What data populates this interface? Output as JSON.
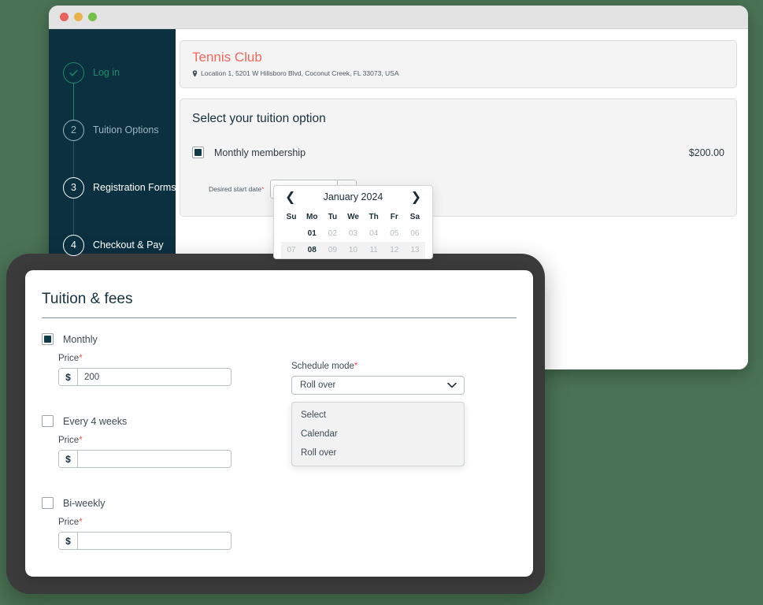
{
  "colors": {
    "page_background": "#4a7355",
    "sidebar_background": "#0b3040",
    "accent_red": "#f4675c",
    "accent_green": "#1d8a68",
    "checkbox_fill": "#0f3a4a",
    "required_mark": "#e8554e",
    "frame": "#3b3b3b"
  },
  "browser": {
    "traffic_lights": [
      "close-red",
      "minimize-yellow",
      "maximize-green"
    ]
  },
  "sidebar": {
    "steps": [
      {
        "marker": "✓",
        "label": "Log in",
        "state": "done"
      },
      {
        "marker": "2",
        "label": "Tuition Options",
        "state": "current"
      },
      {
        "marker": "3",
        "label": "Registration Forms",
        "state": "upcoming"
      },
      {
        "marker": "4",
        "label": "Checkout & Pay",
        "state": "upcoming"
      }
    ]
  },
  "club": {
    "name": "Tennis Club",
    "address": "Location 1, 5201 W Hillsboro Blvd, Coconut Creek, FL 33073, USA",
    "pin_icon": "location-pin-icon"
  },
  "tuition": {
    "title": "Select your tuition option",
    "option_label": "Monthly membership",
    "option_price": "$200.00",
    "option_checked": true,
    "date_label": "Desired start date",
    "date_required": "*",
    "date_value": "",
    "date_placeholder": "",
    "calendar_icon": "calendar-icon"
  },
  "calendar": {
    "prev_icon": "chevron-left-icon",
    "next_icon": "chevron-right-icon",
    "month_title": "January 2024",
    "weekdays": [
      "Su",
      "Mo",
      "Tu",
      "We",
      "Th",
      "Fr",
      "Sa"
    ],
    "weeks": [
      {
        "alt": false,
        "days": [
          {
            "text": "",
            "strong": false,
            "blank": true
          },
          {
            "text": "01",
            "strong": true
          },
          {
            "text": "02",
            "strong": false
          },
          {
            "text": "03",
            "strong": false
          },
          {
            "text": "04",
            "strong": false
          },
          {
            "text": "05",
            "strong": false
          },
          {
            "text": "06",
            "strong": false
          }
        ]
      },
      {
        "alt": true,
        "days": [
          {
            "text": "07",
            "strong": false
          },
          {
            "text": "08",
            "strong": true
          },
          {
            "text": "09",
            "strong": false
          },
          {
            "text": "10",
            "strong": false
          },
          {
            "text": "11",
            "strong": false
          },
          {
            "text": "12",
            "strong": false
          },
          {
            "text": "13",
            "strong": false
          }
        ]
      }
    ]
  },
  "modal": {
    "title": "Tuition & fees",
    "groups": [
      {
        "label": "Monthly",
        "checked": true,
        "price_label": "Price",
        "price_required": "*",
        "currency": "$",
        "price_value": "200"
      },
      {
        "label": "Every 4 weeks",
        "checked": false,
        "price_label": "Price",
        "price_required": "*",
        "currency": "$",
        "price_value": ""
      },
      {
        "label": "Bi-weekly",
        "checked": false,
        "price_label": "Price",
        "price_required": "*",
        "currency": "$",
        "price_value": ""
      }
    ],
    "schedule": {
      "label": "Schedule mode",
      "required": "*",
      "selected": "Roll over",
      "chevron_icon": "chevron-down-icon",
      "open": true,
      "options": [
        "Select",
        "Calendar",
        "Roll over"
      ]
    }
  }
}
